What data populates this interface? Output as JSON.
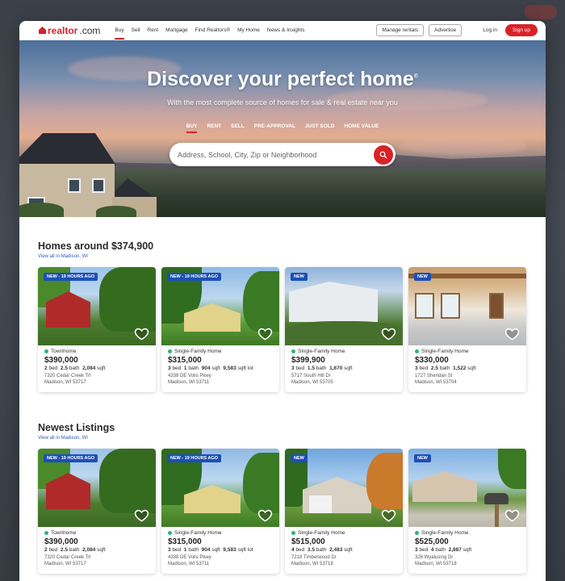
{
  "brand": {
    "logo": "realtor",
    "logo_suffix": ".com"
  },
  "nav": {
    "links": [
      "Buy",
      "Sell",
      "Rent",
      "Mortgage",
      "Find Realtors®",
      "My Home",
      "News & Insights"
    ],
    "manage_rentals": "Manage rentals",
    "advertise": "Advertise",
    "login": "Log in",
    "signup": "Sign up"
  },
  "hero": {
    "title": "Discover your perfect home",
    "title_mark": "®",
    "subtitle": "With the most complete source of homes for sale & real estate near you",
    "tabs": [
      "BUY",
      "RENT",
      "SELL",
      "PRE-APPROVAL",
      "JUST SOLD",
      "HOME VALUE"
    ],
    "search_placeholder": "Address, School, City, Zip or Neighborhood"
  },
  "homes_around": {
    "title": "Homes around $374,900",
    "view_all": "View all in Madison, WI",
    "cards": [
      {
        "badge": "NEW - 19 HOURS AGO",
        "type": "Townhome",
        "price": "$390,000",
        "beds": "2",
        "baths": "2.5",
        "sqft": "2,084",
        "lot": "",
        "street": "7320 Cedar Creek Trl",
        "city": "Madison, WI 53717"
      },
      {
        "badge": "NEW - 19 HOURS AGO",
        "type": "Single-Family Home",
        "price": "$315,000",
        "beds": "3",
        "baths": "1",
        "sqft": "904",
        "lot": "9,583",
        "street": "4338 DE Volis Pkwy",
        "city": "Madison, WI 53711"
      },
      {
        "badge": "NEW",
        "type": "Single-Family Home",
        "price": "$399,900",
        "beds": "3",
        "baths": "1.5",
        "sqft": "1,670",
        "lot": "",
        "street": "5717 South Hill Dr",
        "city": "Madison, WI 53705"
      },
      {
        "badge": "NEW",
        "type": "Single-Family Home",
        "price": "$330,000",
        "beds": "3",
        "baths": "2.5",
        "sqft": "1,522",
        "lot": "",
        "street": "1727 Sheridan St",
        "city": "Madison, WI 53704"
      }
    ]
  },
  "newest": {
    "title": "Newest Listings",
    "view_all": "View all in Madison, WI",
    "cards": [
      {
        "badge": "NEW - 19 HOURS AGO",
        "type": "Townhome",
        "price": "$390,000",
        "beds": "2",
        "baths": "2.5",
        "sqft": "2,084",
        "lot": "",
        "street": "7320 Cedar Creek Trl",
        "city": "Madison, WI 53717"
      },
      {
        "badge": "NEW - 19 HOURS AGO",
        "type": "Single-Family Home",
        "price": "$315,000",
        "beds": "3",
        "baths": "1",
        "sqft": "904",
        "lot": "9,583",
        "street": "4338 DE Volis Pkwy",
        "city": "Madison, WI 53711"
      },
      {
        "badge": "NEW",
        "type": "Single-Family Home",
        "price": "$515,000",
        "beds": "4",
        "baths": "3.5",
        "sqft": "2,483",
        "lot": "",
        "street": "7218 Timberwood Dr",
        "city": "Madison, WI 53719"
      },
      {
        "badge": "NEW",
        "type": "Single-Family Home",
        "price": "$525,000",
        "beds": "3",
        "baths": "4",
        "sqft": "2,887",
        "lot": "",
        "street": "326 Wyalusing Dr",
        "city": "Madison, WI 53718"
      }
    ]
  },
  "labels": {
    "bed": "bed",
    "bath": "bath",
    "sqft": "sqft",
    "sqft_lot": "sqft lot"
  },
  "colors": {
    "brand_red": "#d92228",
    "badge_blue": "#1c4fb6",
    "status_green": "#2bb673",
    "link_blue": "#2f5eb8"
  },
  "icons": {
    "search": "search-icon",
    "heart": "heart-icon",
    "logo": "house-logo-icon"
  }
}
